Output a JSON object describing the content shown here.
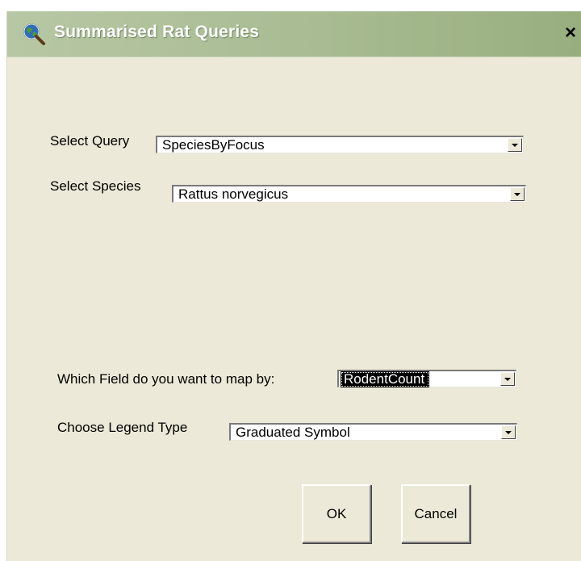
{
  "window": {
    "title": "Summarised Rat Queries",
    "icon": "globe-magnifier-icon",
    "close_icon": "close-icon",
    "close_label": "×"
  },
  "form": {
    "query_label": "Select Query",
    "query_value": "SpeciesByFocus",
    "species_label": "Select Species",
    "species_value": "Rattus norvegicus",
    "map_field_label": "Which Field do you want to map by:",
    "map_field_value": "RodentCount",
    "legend_label": "Choose Legend Type",
    "legend_value": "Graduated Symbol"
  },
  "buttons": {
    "ok_label": "OK",
    "cancel_label": "Cancel"
  },
  "colors": {
    "titlebar": "#a8bb92",
    "dialog_bg": "#ece9d8",
    "selection_bg": "#000000"
  }
}
